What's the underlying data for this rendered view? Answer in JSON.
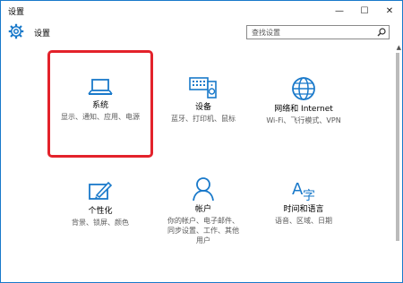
{
  "window": {
    "title": "设置",
    "minimize": "—",
    "maximize": "☐",
    "close": "✕"
  },
  "header": {
    "title": "设置",
    "search_placeholder": "查找设置"
  },
  "tiles": [
    {
      "name": "系统",
      "desc": "显示、通知、应用、电源",
      "icon": "laptop-icon"
    },
    {
      "name": "设备",
      "desc": "蓝牙、打印机、鼠标",
      "icon": "devices-icon"
    },
    {
      "name": "网络和 Internet",
      "desc": "Wi-Fi、飞行模式、VPN",
      "icon": "globe-icon"
    },
    {
      "name": "个性化",
      "desc": "背景、锁屏、颜色",
      "icon": "personalization-icon"
    },
    {
      "name": "帐户",
      "desc": "你的帐户、电子邮件、同步设置、工作、其他用户",
      "icon": "person-icon"
    },
    {
      "name": "时间和语言",
      "desc": "语音、区域、日期",
      "icon": "time-language-icon"
    }
  ],
  "colors": {
    "accent": "#1979ca",
    "highlight": "#e3222b"
  }
}
